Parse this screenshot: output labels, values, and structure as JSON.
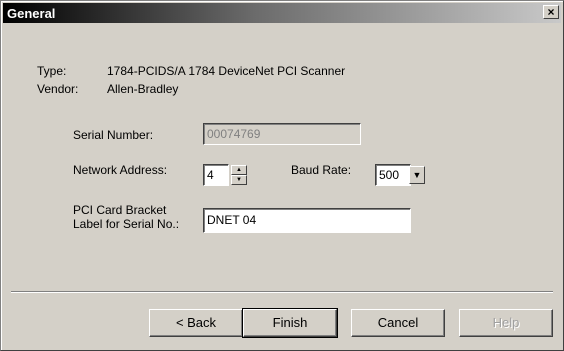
{
  "window": {
    "title": "General",
    "close_glyph": "×"
  },
  "info": {
    "type_label": "Type:",
    "type_value": "1784-PCIDS/A 1784 DeviceNet PCI Scanner",
    "vendor_label": "Vendor:",
    "vendor_value": "Allen-Bradley"
  },
  "form": {
    "serial_label": "Serial Number:",
    "serial_value": "00074769",
    "network_label": "Network Address:",
    "network_value": "4",
    "baud_label": "Baud Rate:",
    "baud_value": "500",
    "bracket_label_line1": "PCI Card Bracket",
    "bracket_label_line2": "Label for Serial No.:",
    "bracket_value": "DNET 04"
  },
  "buttons": {
    "back": "< Back",
    "finish": "Finish",
    "cancel": "Cancel",
    "help": "Help"
  }
}
